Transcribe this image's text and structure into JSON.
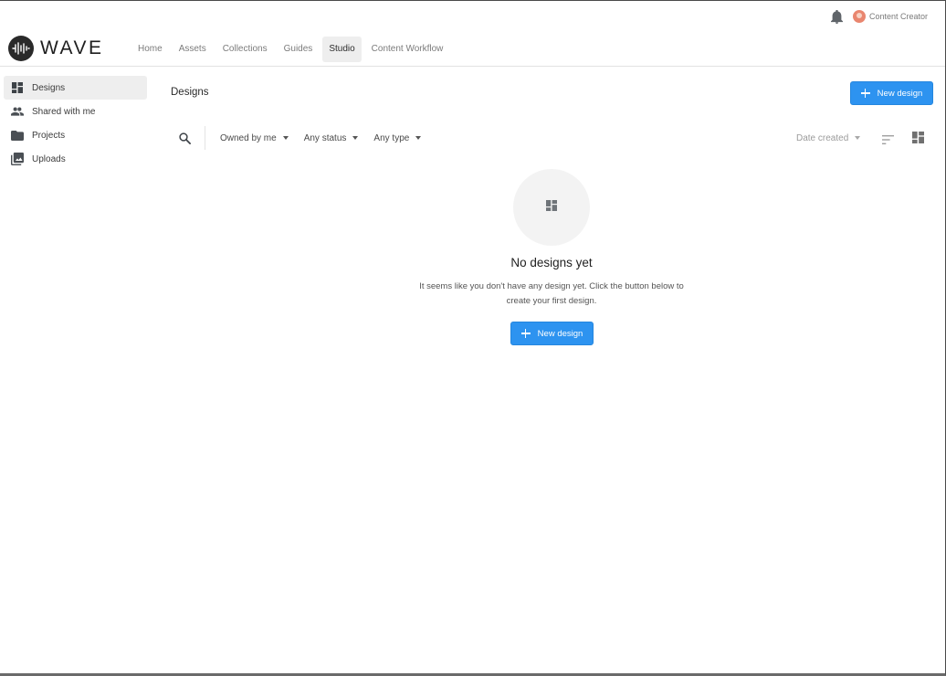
{
  "header": {
    "brand": "WAVE",
    "user_name": "Content Creator",
    "nav": [
      {
        "label": "Home"
      },
      {
        "label": "Assets"
      },
      {
        "label": "Collections"
      },
      {
        "label": "Guides"
      },
      {
        "label": "Studio",
        "active": true
      },
      {
        "label": "Content Workflow"
      }
    ]
  },
  "sidebar": {
    "items": [
      {
        "label": "Designs",
        "icon": "dashboard-icon",
        "active": true
      },
      {
        "label": "Shared with me",
        "icon": "people-icon"
      },
      {
        "label": "Projects",
        "icon": "folder-icon"
      },
      {
        "label": "Uploads",
        "icon": "photo-library-icon"
      }
    ]
  },
  "main": {
    "title": "Designs",
    "new_design_label": "New design",
    "filters": {
      "owner": "Owned by me",
      "status": "Any status",
      "type": "Any type"
    },
    "sort": {
      "label": "Date created"
    },
    "empty_state": {
      "title": "No designs yet",
      "line1": "It seems like you don't have any design yet. Click the button below to",
      "line2": "create your first design.",
      "button_label": "New design"
    }
  },
  "colors": {
    "accent": "#2d93f0",
    "active_bg": "#eeeeee",
    "border": "#e2e2e2"
  }
}
